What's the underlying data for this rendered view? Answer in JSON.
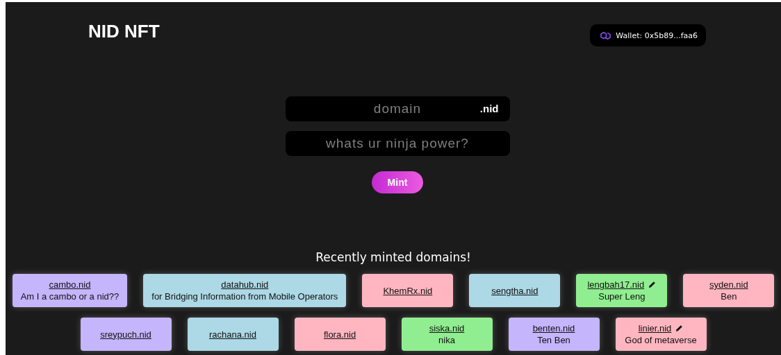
{
  "header": {
    "title": "NID NFT",
    "wallet": "Wallet: 0x5b89...faa6"
  },
  "form": {
    "domain_placeholder": "domain",
    "tld": ".nid",
    "power_placeholder": "whats ur ninja power?",
    "mint_button": "Mint"
  },
  "recent": {
    "heading": "Recently minted domains!",
    "domains": [
      {
        "name": "cambo.nid",
        "record": "Am I a cambo or a nid??",
        "color": "#c4b5fd",
        "editable": false
      },
      {
        "name": "datahub.nid",
        "record": "for Bridging Information from Mobile Operators",
        "color": "#add8e6",
        "editable": false
      },
      {
        "name": "KhemRx.nid",
        "color": "#ffb6c1",
        "editable": false
      },
      {
        "name": "sengtha.nid",
        "color": "#add8e6",
        "editable": false
      },
      {
        "name": "lengbah17.nid",
        "record": "Super Leng",
        "color": "#90ee90",
        "editable": true
      },
      {
        "name": "syden.nid",
        "record": "Ben",
        "color": "#ffb6c1",
        "editable": false
      },
      {
        "name": "sreypuch.nid",
        "color": "#c4b5fd",
        "editable": false
      },
      {
        "name": "rachana.nid",
        "color": "#add8e6",
        "editable": false
      },
      {
        "name": "flora.nid",
        "color": "#ffb6c1",
        "editable": false
      },
      {
        "name": "siska.nid",
        "record": "nika",
        "color": "#90ee90",
        "editable": false
      },
      {
        "name": "benten.nid",
        "record": "Ten Ben",
        "color": "#c4b5fd",
        "editable": false
      },
      {
        "name": "linier.nid",
        "record": "God of metaverse",
        "color": "#ffb6c1",
        "editable": true
      }
    ]
  }
}
